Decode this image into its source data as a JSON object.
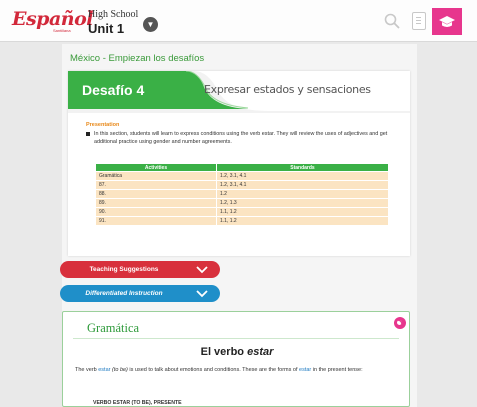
{
  "header": {
    "logo": "Español",
    "logo_sub": "Santillana",
    "level": "High School",
    "unit": "Unit 1",
    "icons": [
      "chevron-down-icon",
      "search-icon",
      "document-icon",
      "graduation-cap-icon"
    ],
    "accent": "#e7368d"
  },
  "chapter_title": "México - Empiezan los desafíos",
  "desafio": {
    "number_label": "Desafío 4",
    "subtitle": "Expresar estados y sensaciones",
    "presentation_heading": "Presentation",
    "presentation_text": "In this section, students will learn to express conditions using the verb estar. They will review the uses of adjectives and get additional practice using gender and number agreements.",
    "table": {
      "headers": [
        "Activities",
        "Standards"
      ],
      "rows": [
        [
          "Gramática",
          "1.2, 3.1, 4.1"
        ],
        [
          "87.",
          "1.2, 3.1, 4.1"
        ],
        [
          "88.",
          "1.2"
        ],
        [
          "89.",
          "1.2, 1.3"
        ],
        [
          "90.",
          "1.1, 1.2"
        ],
        [
          "91.",
          "1.1, 1.2"
        ]
      ]
    },
    "colors": {
      "banner": "#3ab046",
      "table_header": "#3ab046",
      "table_cell": "#fbe4c2"
    }
  },
  "buttons": {
    "teaching": "Teaching Suggestions",
    "differentiated": "Differentiated Instruction"
  },
  "grammar": {
    "heading": "Gramática",
    "verb_prefix": "El verbo ",
    "verb_em": "estar",
    "text_a": "The verb ",
    "text_link1": "estar",
    "text_b": " (to be)",
    "text_c": " is used to talk about emotions and conditions. These are the forms of ",
    "text_link2": "estar",
    "text_d": " in the present tense:",
    "conj_heading": "VERBO ESTAR (TO BE), PRESENTE"
  }
}
